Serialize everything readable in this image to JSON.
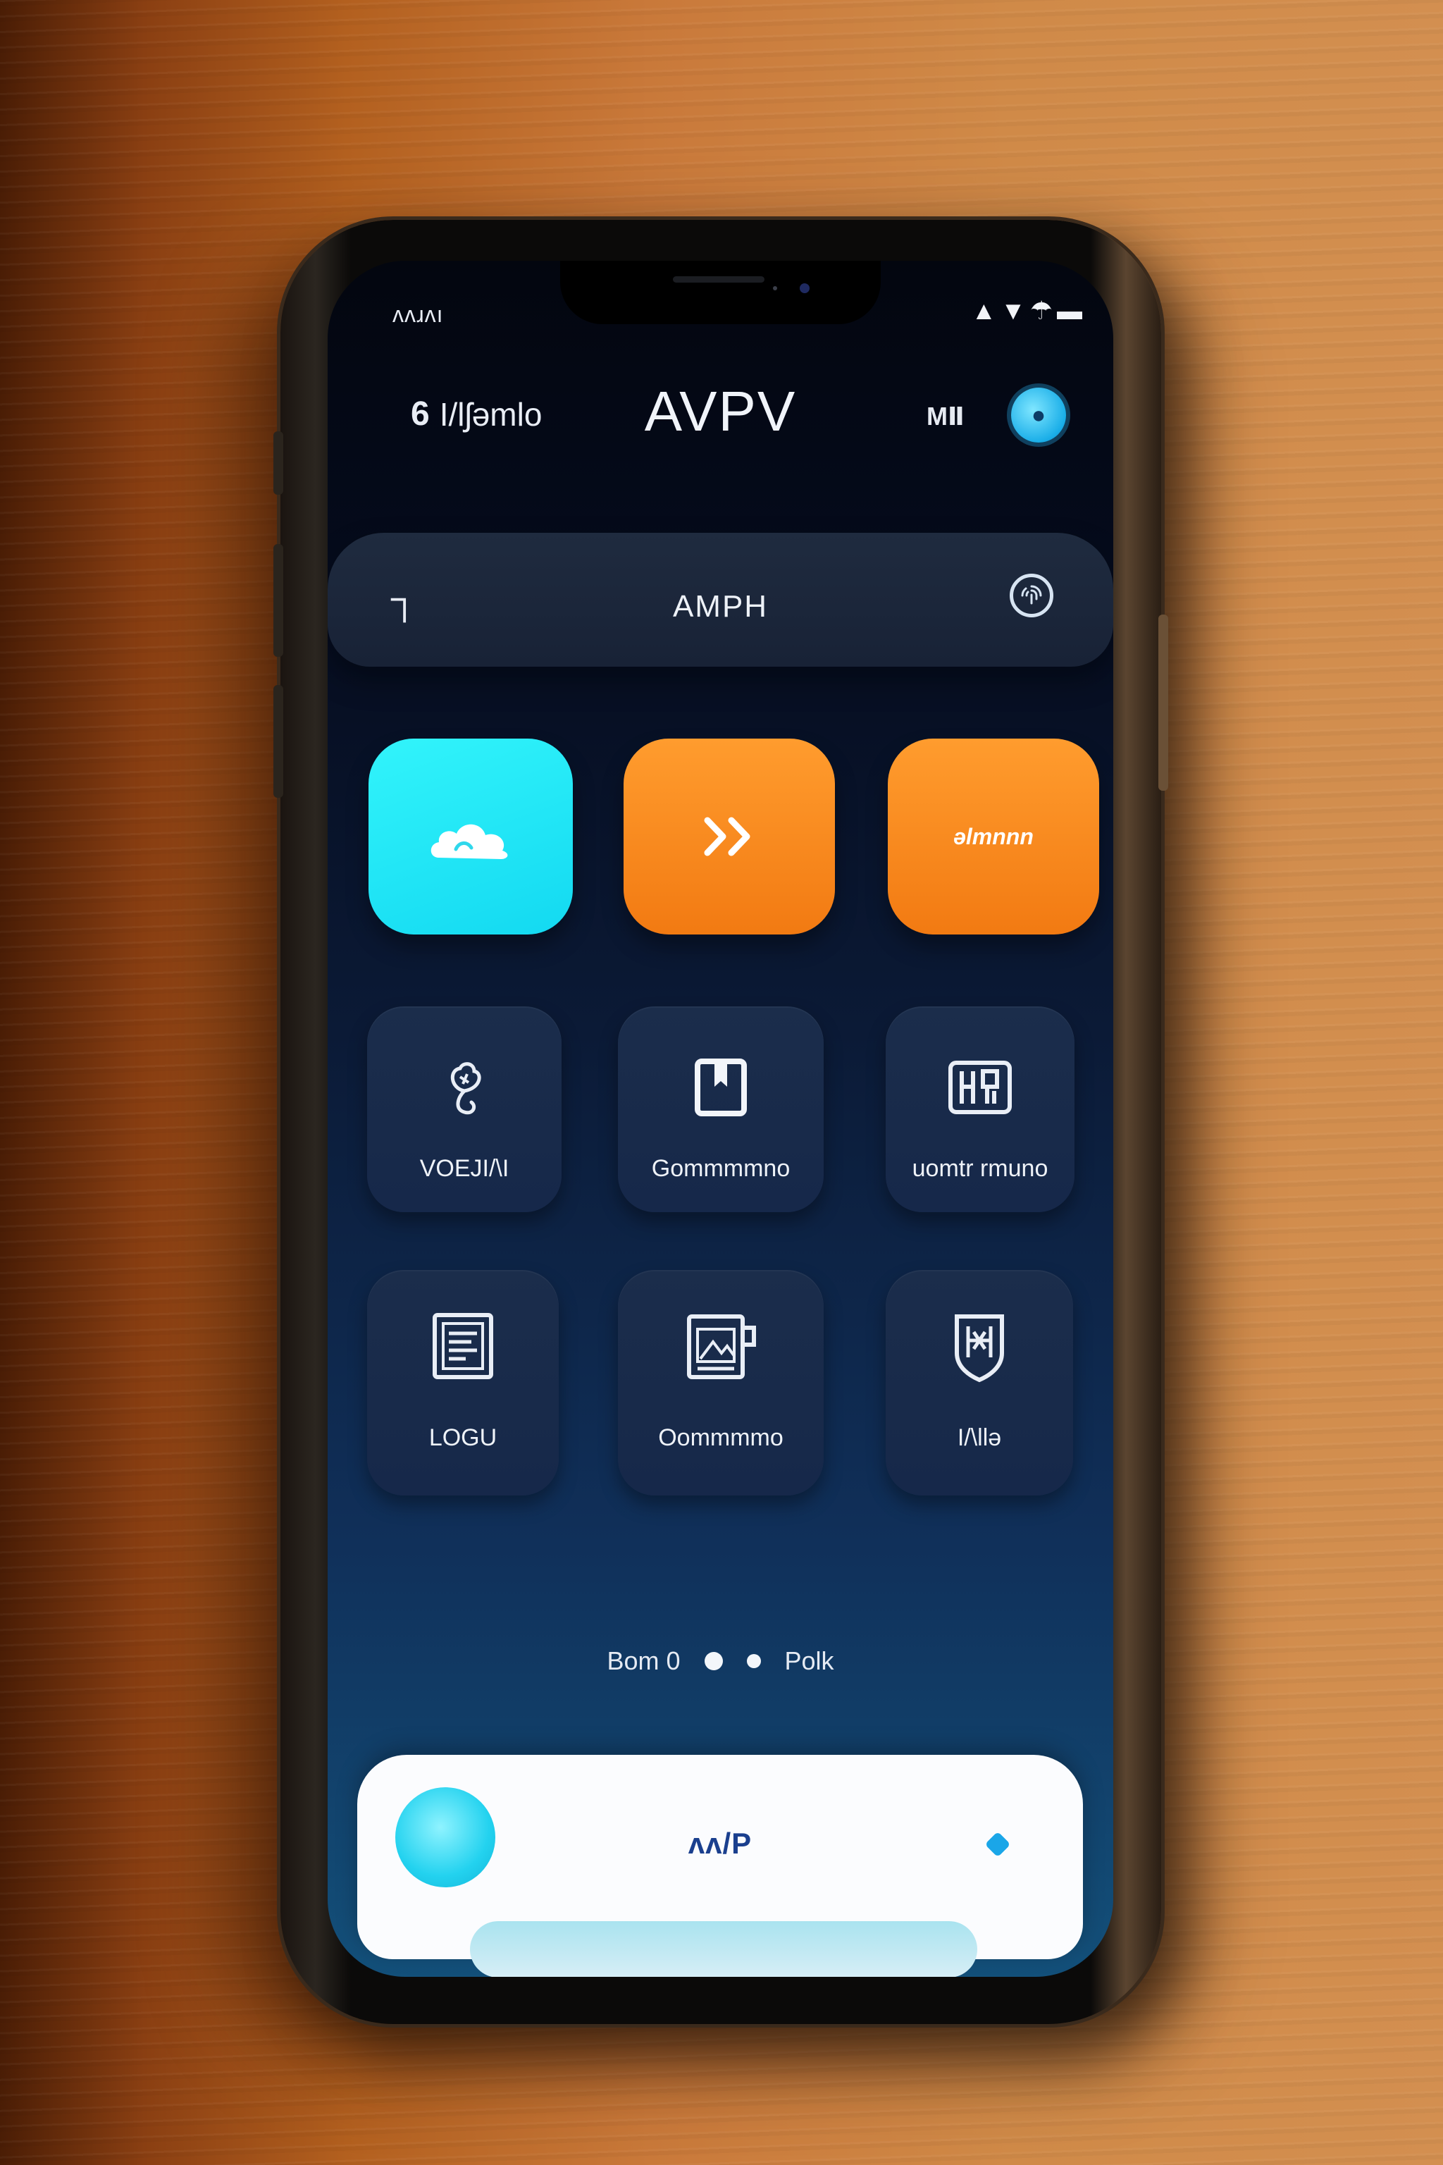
{
  "status_bar": {
    "time": "ʌʌɹʌı",
    "icons": "▲▼☂▬"
  },
  "header": {
    "left_icon": "6",
    "left_label": "I/lʃəmlo",
    "title": "AVPV",
    "right_label": "MⅡ",
    "avatar_icon": "avatar-icon"
  },
  "search": {
    "left_icon": "┐",
    "title": "AMPH",
    "right_icon": "fingerprint-icon"
  },
  "quick_actions": [
    {
      "icon": "cloud-icon",
      "label": "",
      "color": "#1fe6f5"
    },
    {
      "icon": "double-chevron-icon",
      "label": "",
      "color": "#f78a1c"
    },
    {
      "icon": "",
      "label": "əlmnnn",
      "color": "#f78a1c"
    }
  ],
  "tiles": [
    {
      "icon": "flower-icon",
      "label": "VOEJI/\\I"
    },
    {
      "icon": "book-icon",
      "label": "Gommmmno"
    },
    {
      "icon": "building-icon",
      "label": "uomtr rmuno"
    },
    {
      "icon": "document-icon",
      "label": "LOGU"
    },
    {
      "icon": "folder-icon",
      "label": "Oommmmo"
    },
    {
      "icon": "shield-icon",
      "label": "I/\\llə"
    }
  ],
  "pager": {
    "left_label": "Bom 0",
    "right_label": "Polk"
  },
  "bottom_card": {
    "title": "ʌʌ/P",
    "accent": "#1aa6e8"
  }
}
